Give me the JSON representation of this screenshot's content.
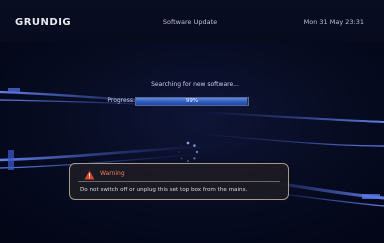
{
  "header": {
    "brand": "GRUNDIG",
    "title": "Software Update",
    "datetime": "Mon 31 May 23:31"
  },
  "status": {
    "searching_text": "Searching for new software..."
  },
  "progress": {
    "label": "Progress:",
    "value_text": "99%",
    "fraction": 0.99,
    "fill_color": "#2c57b8"
  },
  "spinner": {
    "icon": "loading-spinner-icon"
  },
  "warning": {
    "icon": "warning-triangle-icon",
    "title": "Warning",
    "message": "Do not switch off or unplug this set top box from the mains.",
    "title_color": "#ee7e5a"
  }
}
